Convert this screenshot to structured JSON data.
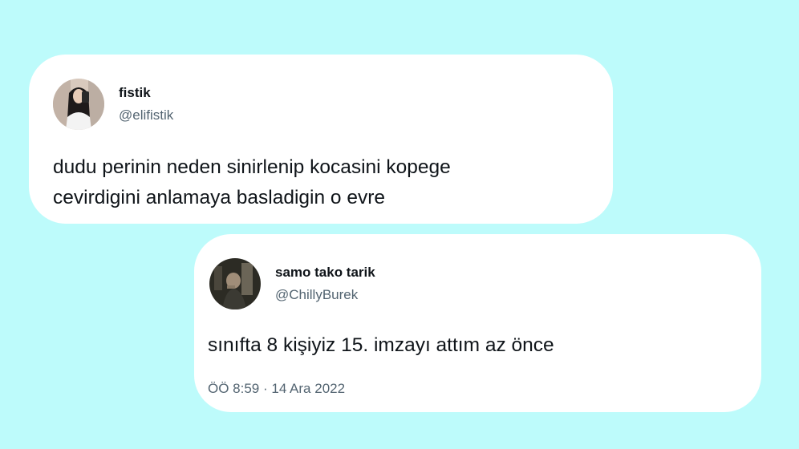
{
  "tweets": [
    {
      "display_name": "fistik",
      "handle": "@elifistik",
      "text_line1": "dudu perinin neden sinirlenip kocasini kopege",
      "text_line2": "cevirdigini anlamaya basladigin o evre"
    },
    {
      "display_name": "samo tako tarik",
      "handle": "@ChillyBurek",
      "text": "sınıfta 8 kişiyiz 15. imzayı attım az önce",
      "timestamp": "ÖÖ 8:59 · 14 Ara 2022"
    }
  ]
}
